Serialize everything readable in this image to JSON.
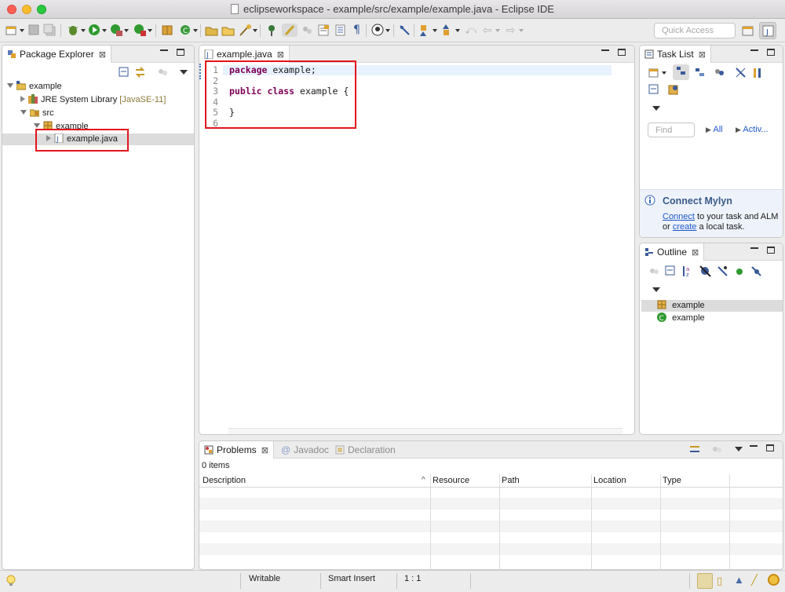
{
  "window": {
    "title": "eclipseworkspace - example/src/example/example.java - Eclipse IDE"
  },
  "toolbar": {
    "quick_access_placeholder": "Quick Access"
  },
  "package_explorer": {
    "title": "Package Explorer",
    "tree": {
      "project": "example",
      "jre_label": "JRE System Library",
      "jre_version": "[JavaSE-11]",
      "src": "src",
      "package": "example",
      "file": "example.java"
    }
  },
  "editor": {
    "tab": "example.java",
    "lines": [
      {
        "num": "1",
        "keyword": "package",
        "rest": " example;"
      },
      {
        "num": "2",
        "keyword": "",
        "rest": ""
      },
      {
        "num": "3",
        "keyword": "public class",
        "rest": " example {"
      },
      {
        "num": "4",
        "keyword": "",
        "rest": ""
      },
      {
        "num": "5",
        "keyword": "",
        "rest": "}"
      },
      {
        "num": "6",
        "keyword": "",
        "rest": ""
      }
    ]
  },
  "task_list": {
    "title": "Task List",
    "find_placeholder": "Find",
    "filter_all": "All",
    "filter_active": "Activ...",
    "mylyn_title": "Connect Mylyn",
    "mylyn_connect": "Connect",
    "mylyn_text1": " to your task and ALM",
    "mylyn_or": "or ",
    "mylyn_create": "create",
    "mylyn_text2": " a local task."
  },
  "outline": {
    "title": "Outline",
    "items": [
      "example",
      "example"
    ]
  },
  "problems": {
    "tabs": [
      "Problems",
      "Javadoc",
      "Declaration"
    ],
    "count": "0 items",
    "columns": [
      "Description",
      "Resource",
      "Path",
      "Location",
      "Type"
    ]
  },
  "status_bar": {
    "writable": "Writable",
    "insert_mode": "Smart Insert",
    "position": "1 : 1"
  },
  "colors": {
    "highlight_box": "#e3141d",
    "keyword": "#7f0055",
    "link": "#1f57c9"
  }
}
